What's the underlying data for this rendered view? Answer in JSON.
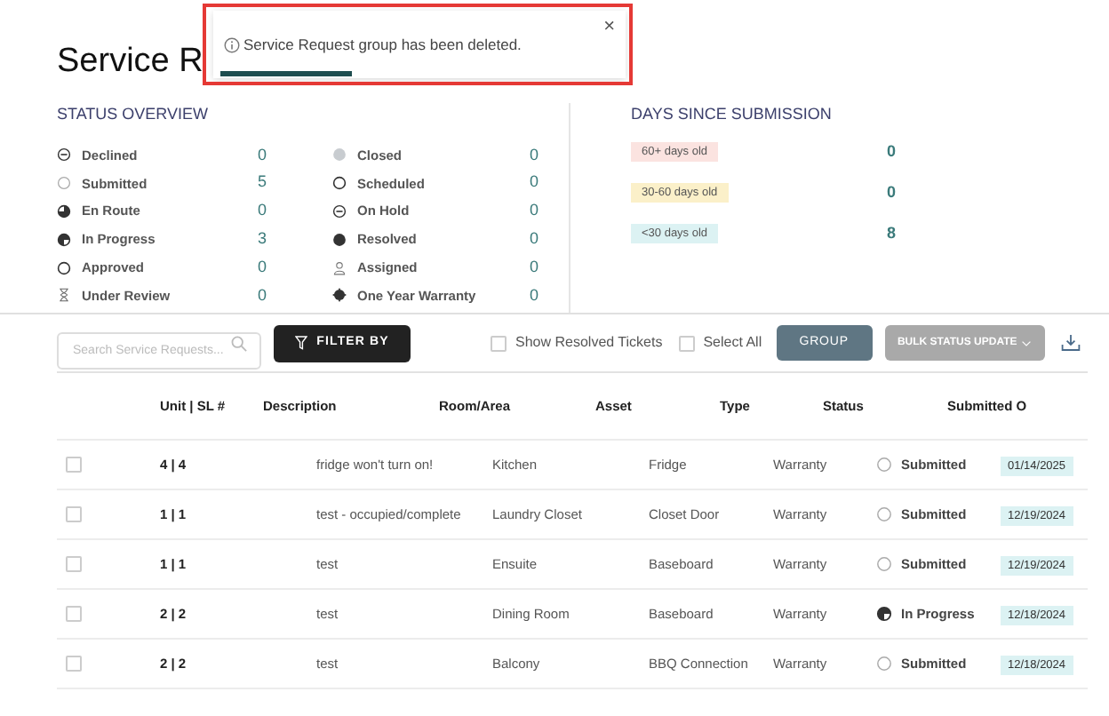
{
  "page_title": "Service R",
  "toast": {
    "message": "Service Request group has been deleted.",
    "close": "×",
    "level": 0.33
  },
  "status_overview": {
    "title": "STATUS OVERVIEW",
    "items": [
      {
        "label": "Declined",
        "count": "0",
        "kind": "minus"
      },
      {
        "label": "Submitted",
        "count": "5",
        "kind": "faint"
      },
      {
        "label": "En Route",
        "count": "0",
        "kind": "quarter"
      },
      {
        "label": "In Progress",
        "count": "3",
        "kind": "half"
      },
      {
        "label": "Approved",
        "count": "0",
        "kind": "ring"
      },
      {
        "label": "Under Review",
        "count": "0",
        "kind": "hourglass"
      },
      {
        "label": "Closed",
        "count": "0",
        "kind": "grey"
      },
      {
        "label": "Scheduled",
        "count": "0",
        "kind": "ring"
      },
      {
        "label": "On Hold",
        "count": "0",
        "kind": "minus"
      },
      {
        "label": "Resolved",
        "count": "0",
        "kind": "solid"
      },
      {
        "label": "Assigned",
        "count": "0",
        "kind": "person"
      },
      {
        "label": "One Year Warranty",
        "count": "0",
        "kind": "burst"
      }
    ]
  },
  "days_since_submission": {
    "title": "DAYS SINCE SUBMISSION",
    "items": [
      {
        "label": "60+ days old",
        "count": "0",
        "color": "#fbe3e0"
      },
      {
        "label": "30-60 days old",
        "count": "0",
        "color": "#fbf0c9"
      },
      {
        "label": "<30 days old",
        "count": "8",
        "color": "#dcf2f3"
      }
    ]
  },
  "toolbar": {
    "search_placeholder": "Search Service Requests...",
    "filter": "FILTER BY",
    "show_resolved": {
      "label": "Show Resolved Tickets",
      "checked": false
    },
    "select_all": {
      "label": "Select All",
      "checked": false
    },
    "group": "GROUP",
    "bulk_update": "BULK STATUS UPDATE"
  },
  "table": {
    "columns": [
      "Unit | SL #",
      "Description",
      "Room/Area",
      "Asset",
      "Type",
      "Status",
      "Submitted O"
    ],
    "rows": [
      {
        "checked": false,
        "unit": "4 | 4",
        "description": "fridge won't turn on!",
        "room": "Kitchen",
        "asset": "Fridge",
        "type": "Warranty",
        "status": "Submitted",
        "kind": "faint",
        "submitted": "01/14/2025"
      },
      {
        "checked": false,
        "unit": "1 | 1",
        "description": "test - occupied/complete",
        "room": "Laundry Closet",
        "asset": "Closet Door",
        "type": "Warranty",
        "status": "Submitted",
        "kind": "faint",
        "submitted": "12/19/2024"
      },
      {
        "checked": false,
        "unit": "1 | 1",
        "description": "test",
        "room": "Ensuite",
        "asset": "Baseboard",
        "type": "Warranty",
        "status": "Submitted",
        "kind": "faint",
        "submitted": "12/19/2024"
      },
      {
        "checked": false,
        "unit": "2 | 2",
        "description": "test",
        "room": "Dining Room",
        "asset": "Baseboard",
        "type": "Warranty",
        "status": "In Progress",
        "kind": "half",
        "submitted": "12/18/2024"
      },
      {
        "checked": false,
        "unit": "2 | 2",
        "description": "test",
        "room": "Balcony",
        "asset": "BBQ Connection",
        "type": "Warranty",
        "status": "Submitted",
        "kind": "faint",
        "submitted": "12/18/2024"
      }
    ]
  }
}
